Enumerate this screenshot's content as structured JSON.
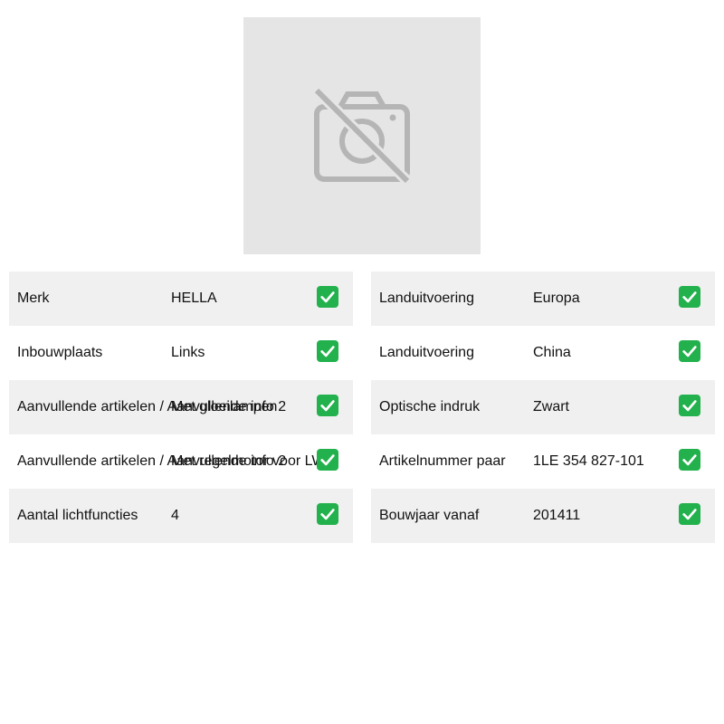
{
  "colors": {
    "check_bg": "#22b14c",
    "row_shaded": "#f0f0f0",
    "image_bg": "#e5e5e5"
  },
  "image": {
    "icon": "no-photo-icon"
  },
  "left_table": [
    {
      "label": "Merk",
      "value": "HELLA",
      "check_icon": "check-mark-icon"
    },
    {
      "label": "Inbouwplaats",
      "value": "Links",
      "check_icon": "check-mark-icon"
    },
    {
      "label": "Aanvullende artikelen / Aanvullende info 2",
      "value": "Met gloeilampen",
      "check_icon": "check-mark-icon"
    },
    {
      "label": "Aanvullende artikelen / Aanvullende info 2",
      "value": "Met regelmotor voor LWR",
      "check_icon": "check-mark-icon"
    },
    {
      "label": "Aantal lichtfuncties",
      "value": "4",
      "check_icon": "check-mark-icon"
    }
  ],
  "right_table": [
    {
      "label": "Landuitvoering",
      "value": "Europa",
      "check_icon": "check-mark-icon"
    },
    {
      "label": "Landuitvoering",
      "value": "China",
      "check_icon": "check-mark-icon"
    },
    {
      "label": "Optische indruk",
      "value": "Zwart",
      "check_icon": "check-mark-icon"
    },
    {
      "label": "Artikelnummer paar",
      "value": "1LE 354 827-101",
      "check_icon": "check-mark-icon"
    },
    {
      "label": "Bouwjaar vanaf",
      "value": "201411",
      "check_icon": "check-mark-icon"
    }
  ]
}
